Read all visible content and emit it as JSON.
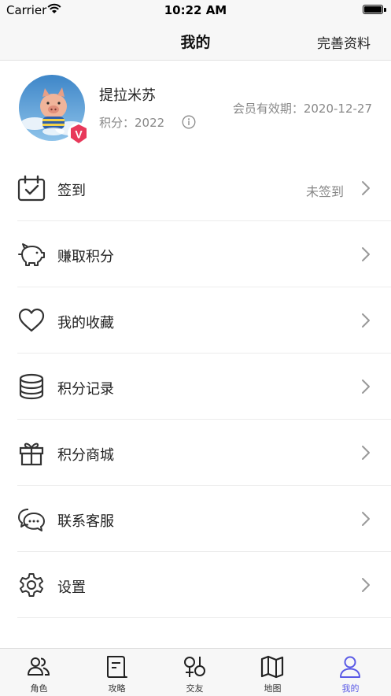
{
  "status_bar": {
    "carrier": "Carrier",
    "time": "10:22 AM"
  },
  "nav": {
    "title": "我的",
    "edit_profile": "完善资料"
  },
  "profile": {
    "username": "提拉米苏",
    "points_text": "积分：2022",
    "expiry_text": "会员有效期：2020-12-27",
    "vip_badge": "V"
  },
  "menu": [
    {
      "icon": "calendar-check-icon",
      "label": "签到",
      "status": "未签到"
    },
    {
      "icon": "piggy-bank-icon",
      "label": "赚取积分",
      "status": ""
    },
    {
      "icon": "heart-icon",
      "label": "我的收藏",
      "status": ""
    },
    {
      "icon": "database-icon",
      "label": "积分记录",
      "status": ""
    },
    {
      "icon": "gift-icon",
      "label": "积分商城",
      "status": ""
    },
    {
      "icon": "chat-bubble-icon",
      "label": "联系客服",
      "status": ""
    },
    {
      "icon": "gear-icon",
      "label": "设置",
      "status": ""
    }
  ],
  "tabs": [
    {
      "icon": "characters-icon",
      "label": "角色",
      "active": false
    },
    {
      "icon": "guide-icon",
      "label": "攻略",
      "active": false
    },
    {
      "icon": "social-icon",
      "label": "交友",
      "active": false
    },
    {
      "icon": "map-icon",
      "label": "地图",
      "active": false
    },
    {
      "icon": "person-icon",
      "label": "我的",
      "active": true
    }
  ],
  "colors": {
    "accent": "#5a5ae6",
    "vip_badge": "#e8385a",
    "text_secondary": "#888888"
  }
}
